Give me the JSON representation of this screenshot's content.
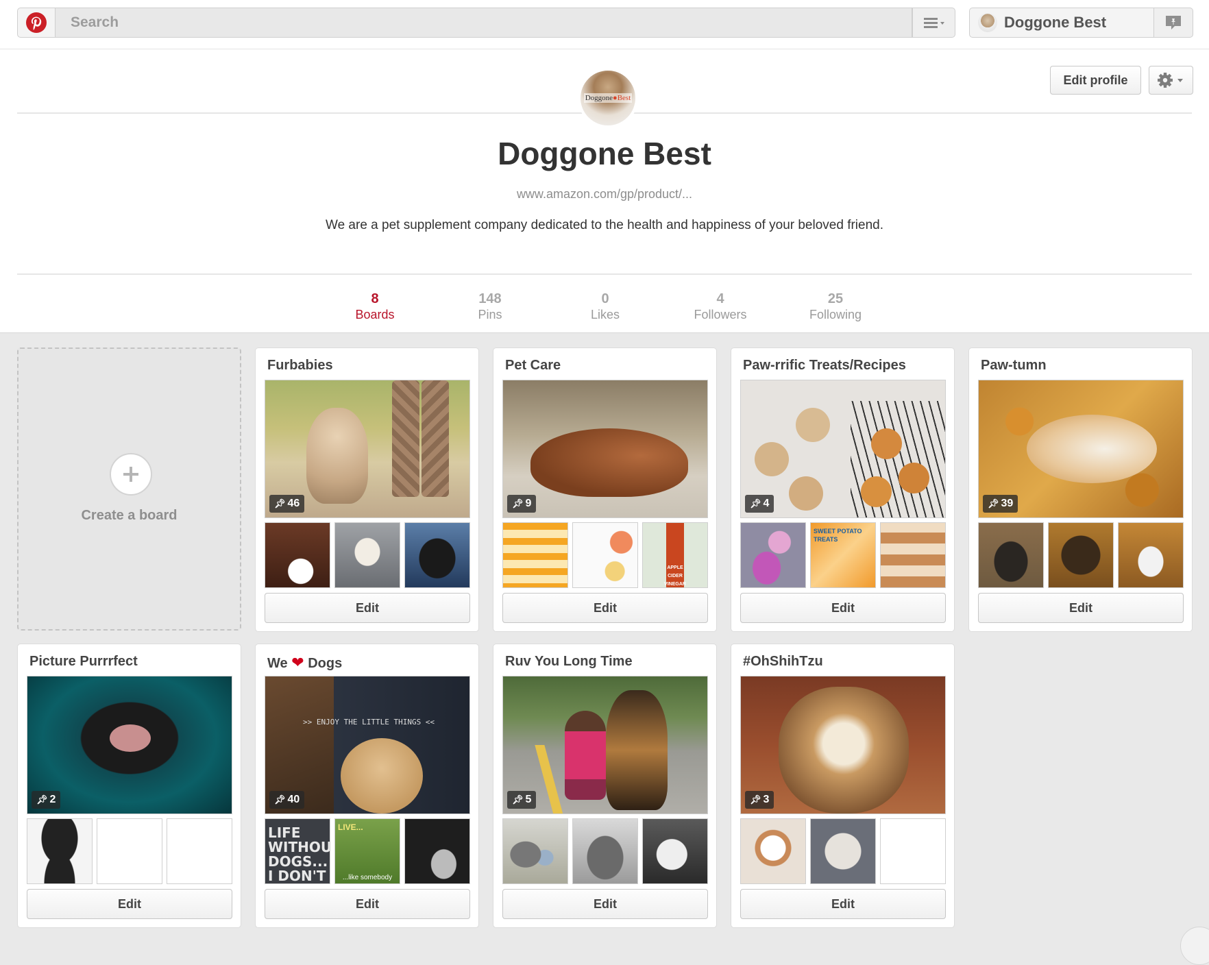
{
  "header": {
    "search_placeholder": "Search",
    "user_name": "Doggone Best"
  },
  "profile": {
    "avatar_text_a": "Doggone",
    "avatar_text_b": "Best",
    "name": "Doggone Best",
    "url": "www.amazon.com/gp/product/...",
    "about": "We are a pet supplement company dedicated to the health and happiness of your beloved friend.",
    "edit_label": "Edit profile",
    "stats": [
      {
        "num": "8",
        "label": "Boards"
      },
      {
        "num": "148",
        "label": "Pins"
      },
      {
        "num": "0",
        "label": "Likes"
      },
      {
        "num": "4",
        "label": "Followers"
      },
      {
        "num": "25",
        "label": "Following"
      }
    ]
  },
  "create_board_label": "Create a board",
  "edit_label": "Edit",
  "boards": [
    {
      "title": "Furbabies",
      "pins": "46"
    },
    {
      "title": "Pet Care",
      "pins": "9"
    },
    {
      "title": "Paw-rrific Treats/Recipes",
      "pins": "4"
    },
    {
      "title": "Paw-tumn",
      "pins": "39"
    },
    {
      "title": "Picture Purrrfect",
      "pins": "2"
    },
    {
      "title_a": "We",
      "title_b": "Dogs",
      "pins": "40"
    },
    {
      "title": "Ruv You Long Time",
      "pins": "5"
    },
    {
      "title": "#OhShihTzu",
      "pins": "3"
    }
  ],
  "thumb_texts": {
    "enjoy": ">> ENJOY THE LITTLE THINGS <<",
    "life": "LIFE WITHOUT DOGS... I DON'T",
    "live": "LIVE...",
    "like": "...like somebody",
    "treats": "SWEET POTATO TREATS",
    "vinegar": "APPLE CIDER VINEGAR"
  },
  "colors": {
    "brand_red": "#cb2027",
    "active_tab": "#b8142a"
  }
}
